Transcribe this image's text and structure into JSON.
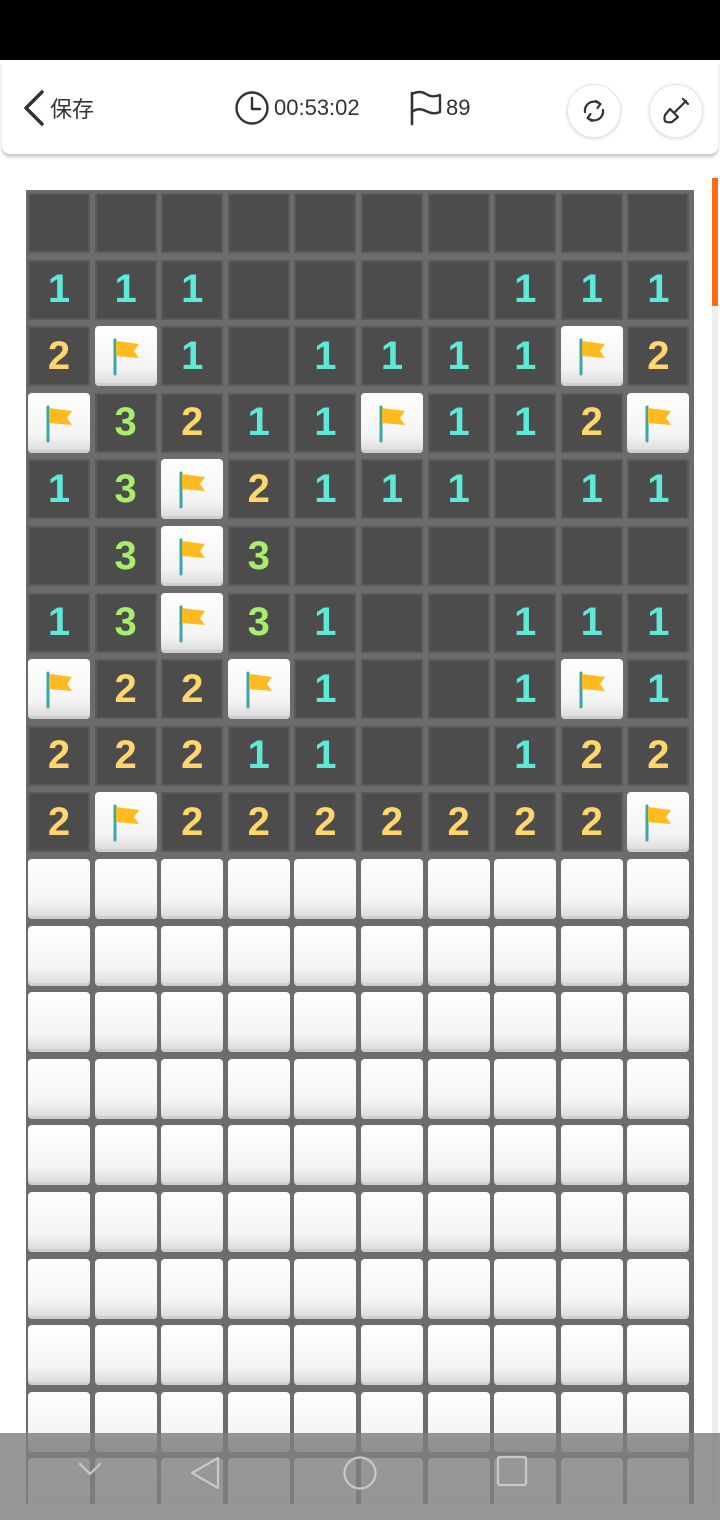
{
  "toolbar": {
    "back_label": "保存",
    "timer": "00:53:02",
    "flags_remaining": "89"
  },
  "colors": {
    "num_1": "#5ee8d8",
    "num_2": "#ffd66b",
    "num_3": "#a8ee6a",
    "flag": "#ffba1f",
    "accent": "#ff6a13"
  },
  "board": {
    "columns": 10,
    "visible_rows": 20,
    "legend": "number = revealed count, E = revealed empty, F = flagged, C = covered",
    "rows": [
      [
        "E",
        "E",
        "E",
        "E",
        "E",
        "E",
        "E",
        "E",
        "E",
        "E"
      ],
      [
        "1",
        "1",
        "1",
        "E",
        "E",
        "E",
        "E",
        "1",
        "1",
        "1"
      ],
      [
        "2",
        "F",
        "1",
        "E",
        "1",
        "1",
        "1",
        "1",
        "F",
        "2"
      ],
      [
        "F",
        "3",
        "2",
        "1",
        "1",
        "F",
        "1",
        "1",
        "2",
        "F"
      ],
      [
        "1",
        "3",
        "F",
        "2",
        "1",
        "1",
        "1",
        "E",
        "1",
        "1"
      ],
      [
        "E",
        "3",
        "F",
        "3",
        "E",
        "E",
        "E",
        "E",
        "E",
        "E"
      ],
      [
        "1",
        "3",
        "F",
        "3",
        "1",
        "E",
        "E",
        "1",
        "1",
        "1"
      ],
      [
        "F",
        "2",
        "2",
        "F",
        "1",
        "E",
        "E",
        "1",
        "F",
        "1"
      ],
      [
        "2",
        "2",
        "2",
        "1",
        "1",
        "E",
        "E",
        "1",
        "2",
        "2"
      ],
      [
        "2",
        "F",
        "2",
        "2",
        "2",
        "2",
        "2",
        "2",
        "2",
        "F"
      ],
      [
        "C",
        "C",
        "C",
        "C",
        "C",
        "C",
        "C",
        "C",
        "C",
        "C"
      ],
      [
        "C",
        "C",
        "C",
        "C",
        "C",
        "C",
        "C",
        "C",
        "C",
        "C"
      ],
      [
        "C",
        "C",
        "C",
        "C",
        "C",
        "C",
        "C",
        "C",
        "C",
        "C"
      ],
      [
        "C",
        "C",
        "C",
        "C",
        "C",
        "C",
        "C",
        "C",
        "C",
        "C"
      ],
      [
        "C",
        "C",
        "C",
        "C",
        "C",
        "C",
        "C",
        "C",
        "C",
        "C"
      ],
      [
        "C",
        "C",
        "C",
        "C",
        "C",
        "C",
        "C",
        "C",
        "C",
        "C"
      ],
      [
        "C",
        "C",
        "C",
        "C",
        "C",
        "C",
        "C",
        "C",
        "C",
        "C"
      ],
      [
        "C",
        "C",
        "C",
        "C",
        "C",
        "C",
        "C",
        "C",
        "C",
        "C"
      ],
      [
        "C",
        "C",
        "C",
        "C",
        "C",
        "C",
        "C",
        "C",
        "C",
        "C"
      ],
      [
        "C",
        "C",
        "C",
        "C",
        "C",
        "C",
        "C",
        "C",
        "C",
        "C"
      ]
    ]
  },
  "icons": {
    "back": "chevron-left-icon",
    "timer": "clock-icon",
    "flags": "flag-outline-icon",
    "restart": "refresh-icon",
    "tool": "shovel-icon",
    "nav_down": "chevron-down-icon",
    "nav_back": "triangle-back-icon",
    "nav_home": "circle-home-icon",
    "nav_recent": "square-recent-icon"
  }
}
